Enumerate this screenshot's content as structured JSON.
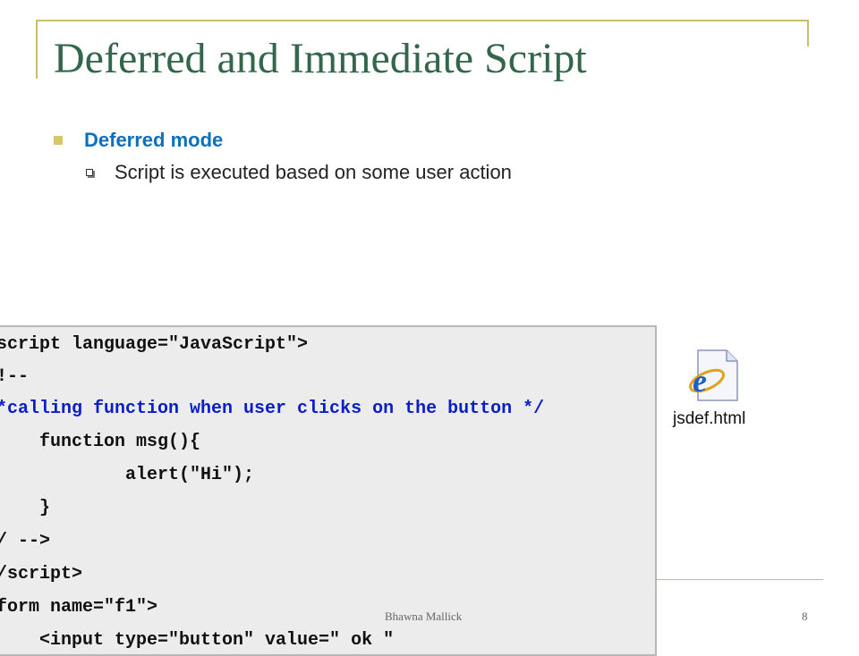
{
  "slide": {
    "title": "Deferred and Immediate Script",
    "bullets": [
      {
        "text": "Deferred mode",
        "level": 1
      },
      {
        "text": "Script is executed based on some user action",
        "level": 2
      }
    ]
  },
  "code": {
    "lines": [
      "script language=\"JavaScript\">",
      "!--",
      "*calling function when user clicks on the button */",
      "    function msg(){",
      "            alert(\"Hi\");",
      "    }",
      "/ -->",
      "/script>",
      "form name=\"f1\">",
      "    <input type=\"button\" value=\" ok \""
    ]
  },
  "file": {
    "name": "jsdef.html",
    "icon": "ie-html-file-icon"
  },
  "footer": {
    "author": "Bhawna Mallick",
    "page": "8"
  },
  "colors": {
    "title": "#33664a",
    "accent": "#c9bd72",
    "bullet_text": "#0d6fc0",
    "comment_code": "#0a1ec8"
  }
}
